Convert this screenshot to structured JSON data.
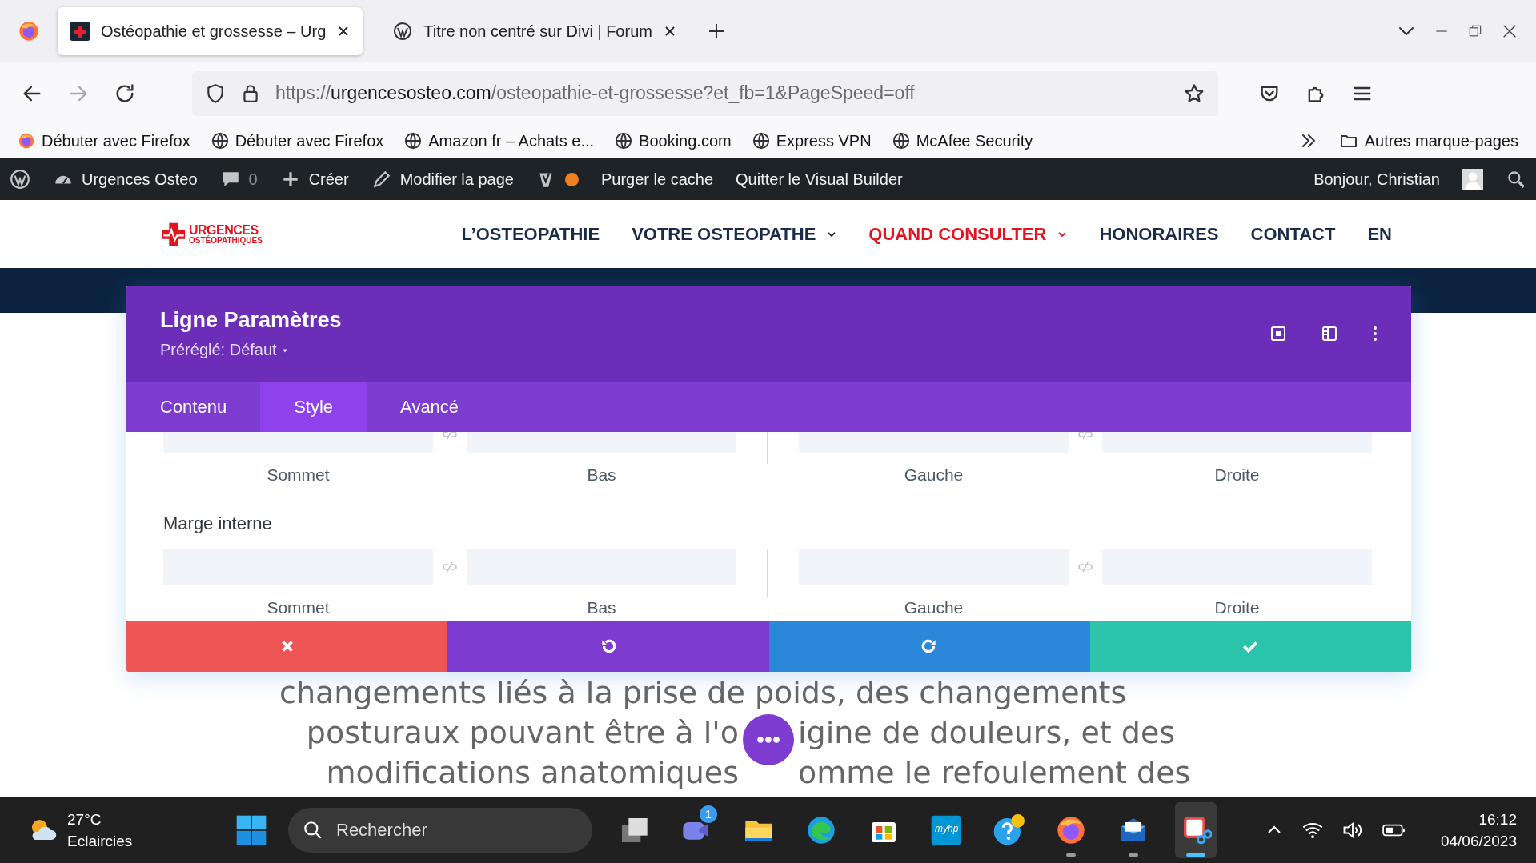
{
  "browser": {
    "tabs": [
      {
        "title": "Ostéopathie et grossesse – Urg",
        "kind": "site",
        "selected": true
      },
      {
        "title": "Titre non centré sur Divi | Forum",
        "kind": "wordpress",
        "selected": false
      }
    ],
    "url": {
      "scheme": "https://",
      "domain": "urgencesosteo.com",
      "path": "/osteopathie-et-grossesse?et_fb=1&PageSpeed=off"
    },
    "bookmarks": [
      {
        "label": "Débuter avec Firefox",
        "kind": "firefox"
      },
      {
        "label": "Débuter avec Firefox",
        "kind": "globe"
      },
      {
        "label": "Amazon fr – Achats e...",
        "kind": "globe"
      },
      {
        "label": "Booking.com",
        "kind": "globe"
      },
      {
        "label": "Express VPN",
        "kind": "globe"
      },
      {
        "label": "McAfee Security",
        "kind": "globe"
      }
    ],
    "other_bookmarks": "Autres marque-pages"
  },
  "admin_bar": {
    "items": [
      {
        "kind": "wp"
      },
      {
        "kind": "site",
        "label": "Urgences Osteo"
      },
      {
        "kind": "comments",
        "label": "0"
      },
      {
        "kind": "new",
        "label": "Créer"
      },
      {
        "kind": "edit",
        "label": "Modifier la page"
      },
      {
        "kind": "seo",
        "color": "#f0801e"
      },
      {
        "kind": "text",
        "label": "Purger le cache"
      },
      {
        "kind": "text",
        "label": "Quitter le Visual Builder"
      }
    ],
    "greeting": "Bonjour, Christian"
  },
  "site_nav": {
    "logo": {
      "line1": "URGENCES",
      "line2": "OSTÉOPATHIQUES"
    },
    "items": [
      {
        "label": "L’OSTEOPATHIE",
        "dropdown": false,
        "selected": false
      },
      {
        "label": "VOTRE OSTEOPATHE",
        "dropdown": true,
        "selected": false
      },
      {
        "label": "QUAND CONSULTER",
        "dropdown": true,
        "selected": true
      },
      {
        "label": "HONORAIRES",
        "dropdown": false,
        "selected": false
      },
      {
        "label": "CONTACT",
        "dropdown": false,
        "selected": false
      },
      {
        "label": "EN",
        "dropdown": false,
        "selected": false
      }
    ]
  },
  "panel": {
    "title": "Ligne Paramètres",
    "preset": "Préréglé: Défaut",
    "tabs": [
      {
        "label": "Contenu",
        "selected": false
      },
      {
        "label": "Style",
        "selected": true
      },
      {
        "label": "Avancé",
        "selected": false
      }
    ],
    "groups": [
      {
        "fields": [
          "Sommet",
          "Bas",
          "Gauche",
          "Droite"
        ]
      },
      {
        "label": "Marge interne",
        "fields": [
          "Sommet",
          "Bas",
          "Gauche",
          "Droite"
        ]
      }
    ],
    "actions": [
      {
        "kind": "discard"
      },
      {
        "kind": "undo"
      },
      {
        "kind": "redo"
      },
      {
        "kind": "save"
      }
    ]
  },
  "page_text": [
    [
      "changements liés à la prise de poids, des changements"
    ],
    [
      "posturaux pouvant être à l'o",
      "igine de douleurs, et des"
    ],
    [
      "modifications anatomiques",
      "omme le refoulement des"
    ]
  ],
  "taskbar": {
    "weather": {
      "temp": "27°C",
      "desc": "Eclaircies"
    },
    "search": {
      "placeholder": "Rechercher"
    },
    "apps": [
      {
        "kind": "taskview",
        "running": false
      },
      {
        "kind": "chat",
        "running": false,
        "badge": "1"
      },
      {
        "kind": "files",
        "running": false
      },
      {
        "kind": "edge",
        "running": false
      },
      {
        "kind": "store",
        "running": false
      },
      {
        "kind": "hp",
        "running": false,
        "label": "myhp"
      },
      {
        "kind": "help",
        "running": false
      },
      {
        "kind": "firefox",
        "running": true
      },
      {
        "kind": "mail",
        "running": true
      },
      {
        "kind": "snip",
        "running": true,
        "selected": true
      }
    ],
    "time": "16:12",
    "date": "04/06/2023"
  }
}
